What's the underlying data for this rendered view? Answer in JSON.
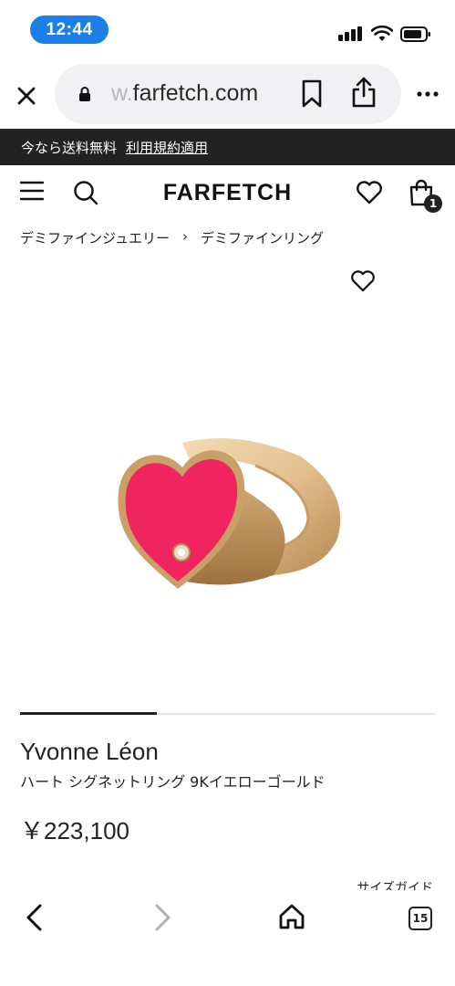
{
  "status_bar": {
    "time": "12:44"
  },
  "browser": {
    "url_faded": "w.",
    "url_main": "farfetch.com"
  },
  "promo": {
    "text": "今なら送料無料",
    "link": "利用規約適用"
  },
  "header": {
    "logo": "FARFETCH",
    "bag_count": "1"
  },
  "breadcrumb": {
    "items": [
      "デミファインジュエリー",
      "›",
      "デミファインリング"
    ]
  },
  "product": {
    "brand": "Yvonne Léon",
    "name": "ハート シグネットリング 9Kイエローゴールド",
    "price": "￥223,100",
    "size_guide": "サイズガイド",
    "carousel_progress": 0.33
  },
  "toolbar": {
    "tabs_count": "15"
  },
  "colors": {
    "accent": "#1a80e5",
    "heart_enamel": "#f0245f",
    "gold": "#e3c08f",
    "dark": "#222222"
  }
}
